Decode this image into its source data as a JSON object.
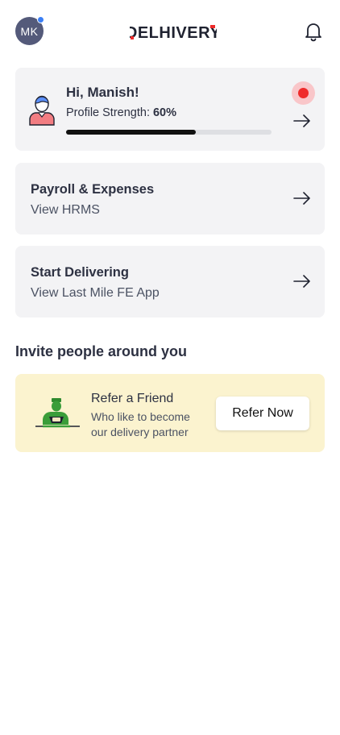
{
  "header": {
    "avatar_initials": "MK",
    "logo_text": "DELHIVERY",
    "notification_icon": "bell-icon"
  },
  "profile": {
    "greeting": "Hi, Manish!",
    "strength_label": "Profile Strength:",
    "strength_value": "60%",
    "strength_fraction": 0.63
  },
  "nav_cards": [
    {
      "title": "Payroll & Expenses",
      "subtitle": "View HRMS"
    },
    {
      "title": "Start Delivering",
      "subtitle": "View Last Mile FE App"
    }
  ],
  "invite": {
    "section_title": "Invite people around you",
    "card_title": "Refer a Friend",
    "card_desc": "Who like to become our delivery partner",
    "button_label": "Refer Now"
  },
  "colors": {
    "accent_red": "#ef2b2b",
    "card_bg": "#f3f3f5",
    "refer_bg": "#fbf3cf",
    "avatar_bg": "#545a7a",
    "notification_dot": "#3b7ff5"
  }
}
